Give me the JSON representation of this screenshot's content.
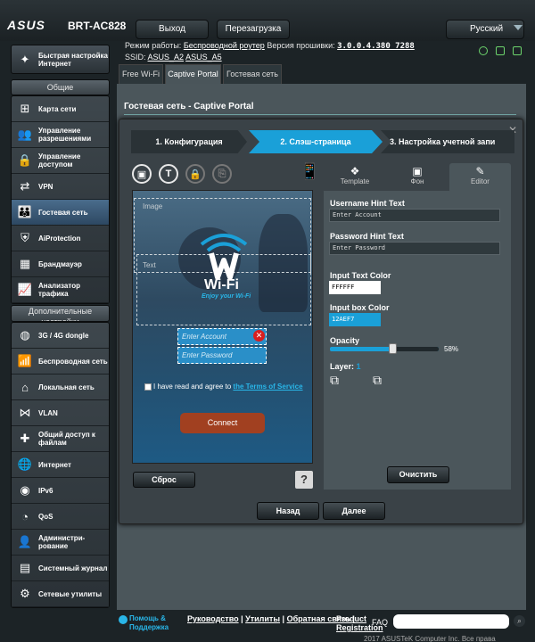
{
  "header": {
    "logo": "ASUS",
    "model": "BRT-AC828",
    "logout": "Выход",
    "reboot": "Перезагрузка",
    "language": "Русский",
    "op_mode_label": "Режим работы:",
    "op_mode_value": "Беспроводной роутер",
    "fw_label": "Версия прошивки:",
    "fw_value": "3.0.0.4.380_7288",
    "ssid_label": "SSID:",
    "ssid1": "ASUS_A2",
    "ssid2": "ASUS_A5"
  },
  "sidebar": {
    "quick_setup": "Быстрая настройка Интернет",
    "general_header": "Общие",
    "general_items": [
      {
        "label": "Карта сети",
        "icon": "network-map-icon",
        "glyph": "⊞"
      },
      {
        "label": "Управление разрешениями",
        "icon": "permissions-icon",
        "glyph": "👥"
      },
      {
        "label": "Управление доступом",
        "icon": "access-control-icon",
        "glyph": "🔒"
      },
      {
        "label": "VPN",
        "icon": "vpn-icon",
        "glyph": "⇄"
      },
      {
        "label": "Гостевая сеть",
        "icon": "guest-network-icon",
        "glyph": "👪"
      },
      {
        "label": "AiProtection",
        "icon": "aiprotection-icon",
        "glyph": "⛨"
      },
      {
        "label": "Брандмауэр",
        "icon": "firewall-icon",
        "glyph": "▦"
      },
      {
        "label": "Анализатор трафика",
        "icon": "traffic-analyzer-icon",
        "glyph": "📈"
      }
    ],
    "advanced_header": "Дополнительные настройки",
    "advanced_items": [
      {
        "label": "3G / 4G dongle",
        "icon": "dongle-icon",
        "glyph": "◍"
      },
      {
        "label": "Беспроводная сеть",
        "icon": "wireless-icon",
        "glyph": "📶"
      },
      {
        "label": "Локальная сеть",
        "icon": "lan-icon",
        "glyph": "⌂"
      },
      {
        "label": "VLAN",
        "icon": "vlan-icon",
        "glyph": "⋈"
      },
      {
        "label": "Общий доступ к файлам",
        "icon": "file-sharing-icon",
        "glyph": "✚"
      },
      {
        "label": "Интернет",
        "icon": "internet-icon",
        "glyph": "🌐"
      },
      {
        "label": "IPv6",
        "icon": "ipv6-icon",
        "glyph": "◉"
      },
      {
        "label": "QoS",
        "icon": "qos-icon",
        "glyph": "◔"
      },
      {
        "label": "Администри-рование",
        "icon": "administration-icon",
        "glyph": "👤"
      },
      {
        "label": "Системный журнал",
        "icon": "system-log-icon",
        "glyph": "▤"
      },
      {
        "label": "Сетевые утилиты",
        "icon": "network-tools-icon",
        "glyph": "⚙"
      }
    ]
  },
  "tabs": [
    "Free Wi-Fi",
    "Captive Portal",
    "Гостевая сеть"
  ],
  "page_title": "Гостевая сеть - Captive Portal",
  "steps": [
    "1. Конфигурация",
    "2. Слэш-страница",
    "3. Настройка учетной запи"
  ],
  "right_tabs": [
    "Template",
    "Фон",
    "Editor"
  ],
  "preview": {
    "image_label": "Image",
    "text_label": "Text",
    "wifi_title": "Wi-Fi",
    "enjoy": "Enjoy your Wi-Fi",
    "account_placeholder": "Enter Account",
    "password_placeholder": "Enter Password",
    "tos_prefix": "I have read and agree to",
    "tos_link": "the Terms of Service",
    "connect": "Connect"
  },
  "editor": {
    "username_hint_label": "Username Hint Text",
    "username_hint_value": "Enter Account",
    "password_hint_label": "Password Hint Text",
    "password_hint_value": "Enter Password",
    "input_text_color_label": "Input Text Color",
    "input_text_color_value": "FFFFFF",
    "input_box_color_label": "Input box Color",
    "input_box_color_value": "12AEF7",
    "opacity_label": "Opacity",
    "opacity_value": "58%",
    "opacity_fraction": 0.58,
    "layer_label": "Layer:",
    "layer_value": "1",
    "clear": "Очистить"
  },
  "buttons": {
    "reset": "Сброс",
    "help": "?",
    "back": "Назад",
    "next": "Далее"
  },
  "footer": {
    "help": "Помощь & Поддержка",
    "manual": "Руководство",
    "utilities": "Утилиты",
    "feedback": "Обратная связь",
    "product_reg": "Product Registration",
    "faq": "FAQ",
    "copyright": "2017 ASUSTeK Computer Inc. Все права защищены."
  },
  "colors": {
    "accent": "#1aa0d8",
    "connect": "#a14020",
    "input_box": "#12AEF7"
  }
}
